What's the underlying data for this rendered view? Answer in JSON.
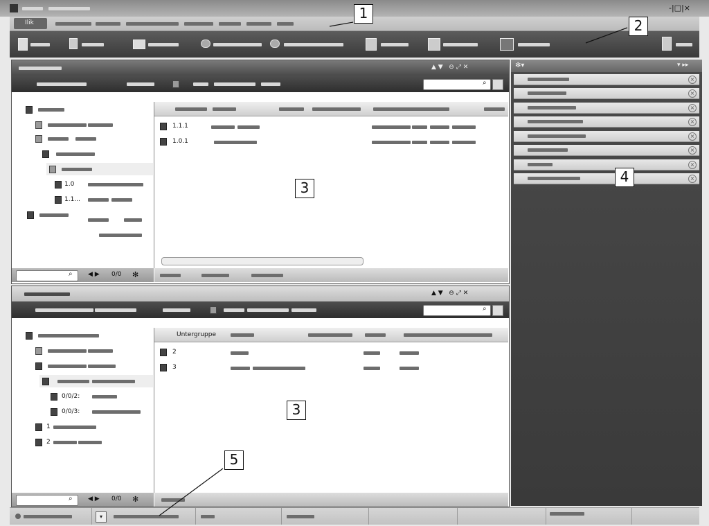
{
  "window": {
    "controls": "-|□|×"
  },
  "menubar": {
    "active_tab": "Ilik"
  },
  "upper_panel": {
    "grid_rows": [
      {
        "id": "1.1.1"
      },
      {
        "id": "1.0.1"
      }
    ],
    "pager": "0/0"
  },
  "lower_panel": {
    "grid_header": "Untergruppe",
    "grid_rows": [
      {
        "id": "2"
      },
      {
        "id": "3"
      }
    ],
    "tree_items": [
      {
        "label": "0/0/2:"
      },
      {
        "label": "0/0/3:"
      },
      {
        "label": "1"
      },
      {
        "label": "2"
      }
    ],
    "pager": "0/0"
  },
  "upper_tree_items": [
    {
      "label": "1.0"
    },
    {
      "label": "1.1..."
    }
  ],
  "callouts": {
    "c1": "1",
    "c2": "2",
    "c3a": "3",
    "c3b": "3",
    "c4": "4",
    "c5": "5"
  }
}
